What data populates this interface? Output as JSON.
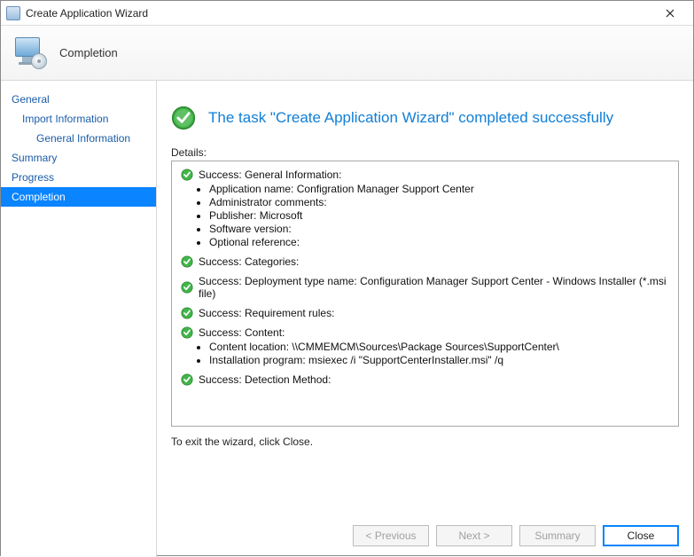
{
  "window": {
    "title": "Create Application Wizard",
    "banner_title": "Completion"
  },
  "sidebar": {
    "items": [
      {
        "label": "General",
        "level": 0
      },
      {
        "label": "Import Information",
        "level": 1
      },
      {
        "label": "General Information",
        "level": 2
      },
      {
        "label": "Summary",
        "level": 0
      },
      {
        "label": "Progress",
        "level": 0
      },
      {
        "label": "Completion",
        "level": 0,
        "selected": true
      }
    ]
  },
  "result": {
    "headline": "The task \"Create Application Wizard\" completed successfully",
    "details_label": "Details:"
  },
  "details": [
    {
      "title": "Success: General Information:",
      "bullets": [
        "Application name: Configration Manager Support Center",
        "Administrator comments:",
        "Publisher: Microsoft",
        "Software version:",
        "Optional reference:"
      ]
    },
    {
      "title": "Success: Categories:"
    },
    {
      "title": "Success: Deployment type name: Configuration Manager Support Center - Windows Installer (*.msi file)"
    },
    {
      "title": "Success: Requirement rules:"
    },
    {
      "title": "Success: Content:",
      "bullets": [
        "Content location: \\\\CMMEMCM\\Sources\\Package Sources\\SupportCenter\\",
        "Installation program: msiexec /i \"SupportCenterInstaller.msi\" /q"
      ]
    },
    {
      "title": "Success: Detection Method:"
    }
  ],
  "exit_note": "To exit the wizard, click Close.",
  "buttons": {
    "previous": "< Previous",
    "next": "Next >",
    "summary": "Summary",
    "close": "Close"
  }
}
